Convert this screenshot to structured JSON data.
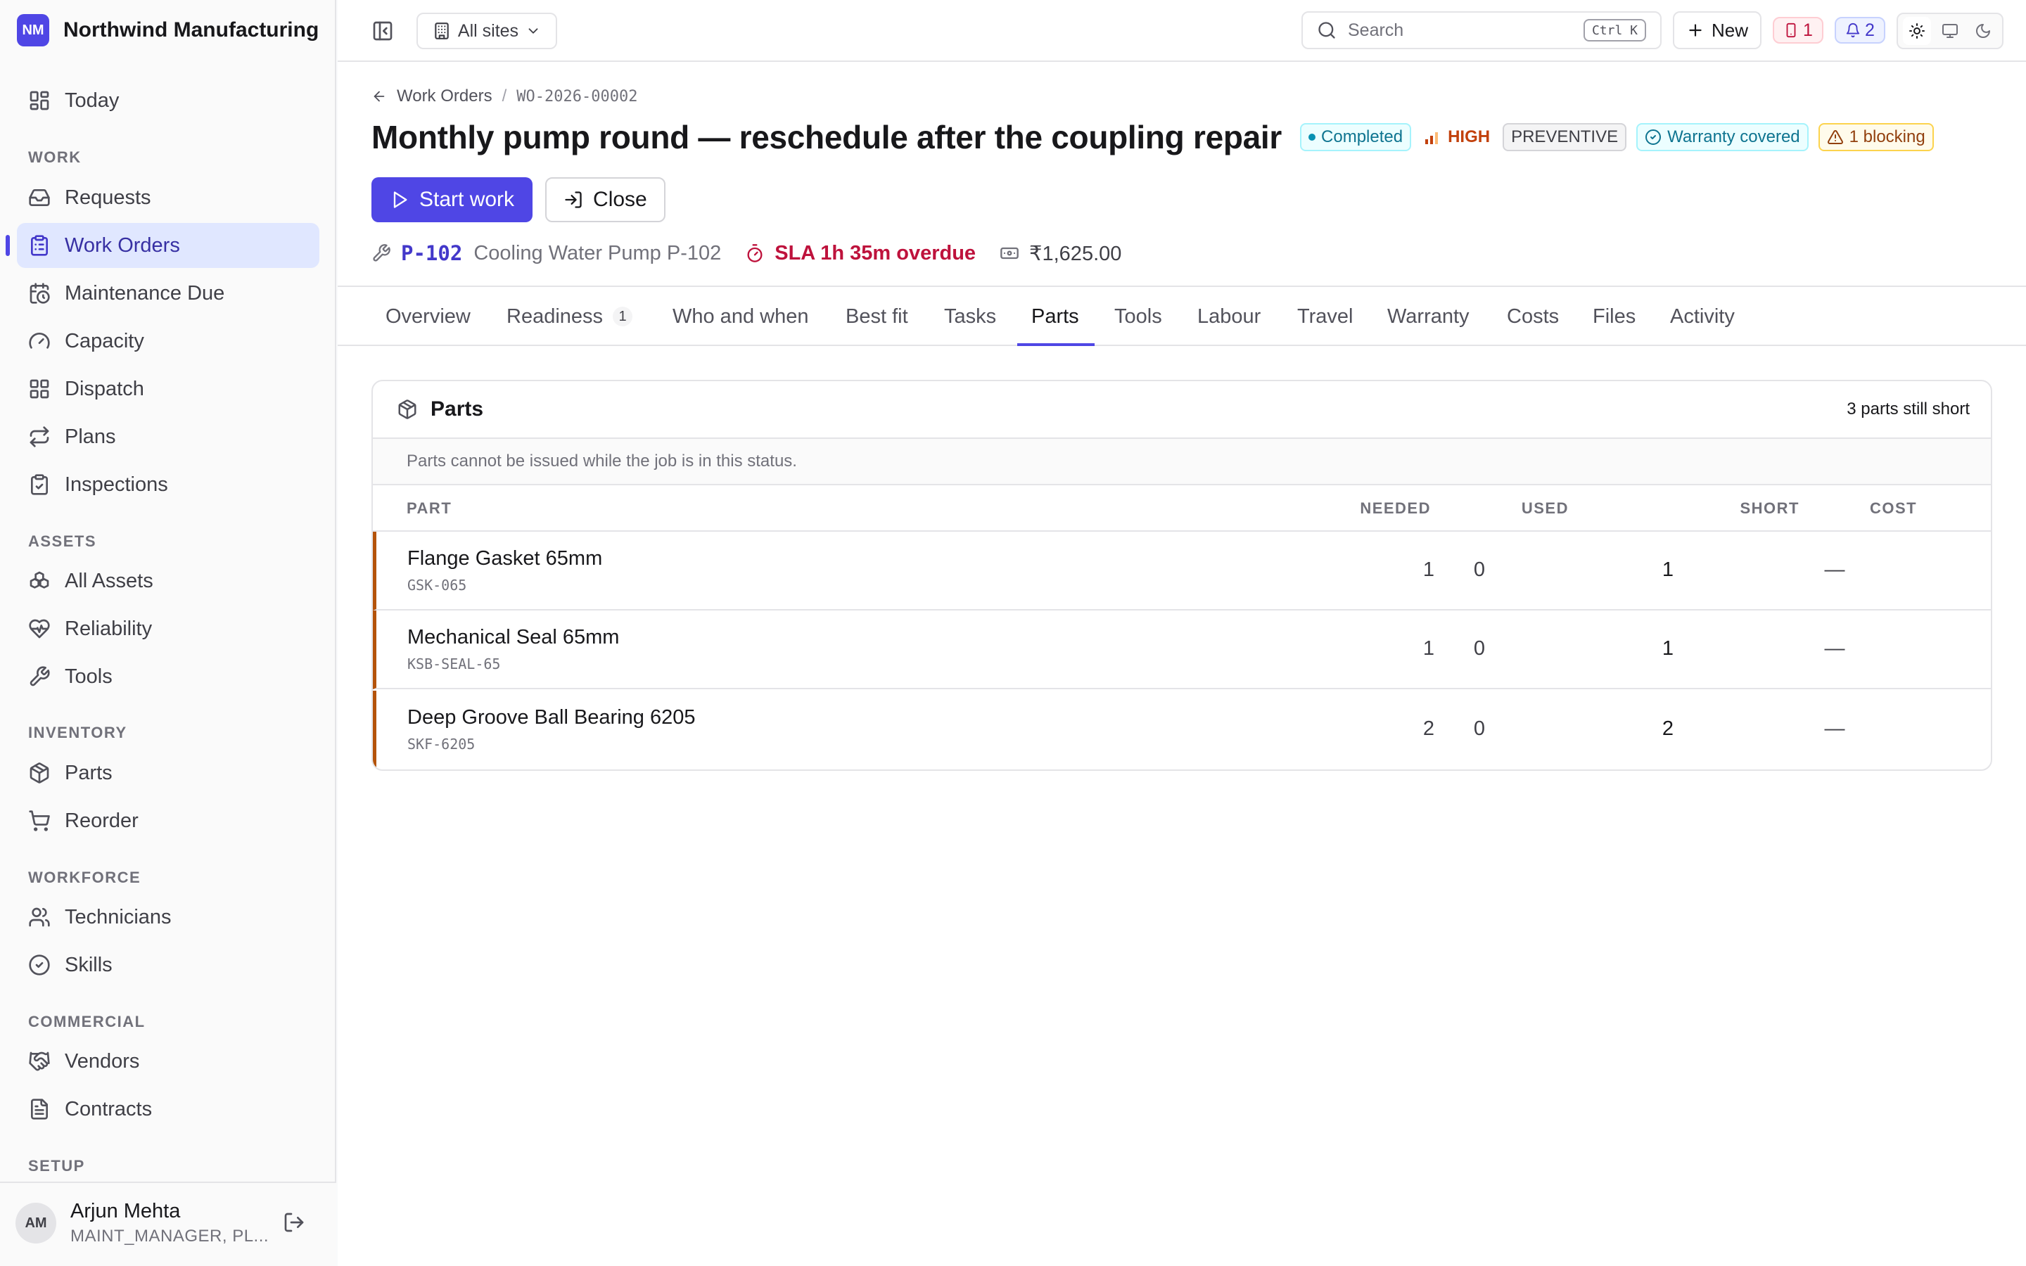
{
  "brand": {
    "initials": "NM",
    "name": "Northwind Manufacturing"
  },
  "sidebar": {
    "today": "Today",
    "sections": {
      "work": "WORK",
      "assets": "ASSETS",
      "inventory": "INVENTORY",
      "workforce": "WORKFORCE",
      "commercial": "COMMERCIAL",
      "setup": "SETUP"
    },
    "items": {
      "requests": "Requests",
      "work_orders": "Work Orders",
      "maintenance_due": "Maintenance Due",
      "capacity": "Capacity",
      "dispatch": "Dispatch",
      "plans": "Plans",
      "inspections": "Inspections",
      "all_assets": "All Assets",
      "reliability": "Reliability",
      "tools": "Tools",
      "parts": "Parts",
      "reorder": "Reorder",
      "technicians": "Technicians",
      "skills": "Skills",
      "vendors": "Vendors",
      "contracts": "Contracts"
    },
    "active": "Work Orders"
  },
  "user": {
    "initials": "AM",
    "name": "Arjun Mehta",
    "role": "MAINT_MANAGER, PL..."
  },
  "topbar": {
    "site_selector": "All sites",
    "search_placeholder": "Search",
    "search_shortcut": "Ctrl K",
    "new_label": "New",
    "alerts_count": "1",
    "notifications_count": "2"
  },
  "breadcrumb": {
    "parent": "Work Orders",
    "current": "WO-2026-00002"
  },
  "work_order": {
    "title": "Monthly pump round — reschedule after the coupling repair",
    "status": "Completed",
    "priority": "HIGH",
    "type": "PREVENTIVE",
    "warranty": "Warranty covered",
    "blocking": "1 blocking",
    "asset_code": "P-102",
    "asset_name": "Cooling Water Pump P-102",
    "sla": "SLA 1h 35m overdue",
    "cost": "₹1,625.00"
  },
  "actions": {
    "start": "Start work",
    "close": "Close"
  },
  "tabs": [
    {
      "label": "Overview"
    },
    {
      "label": "Readiness",
      "count": "1"
    },
    {
      "label": "Who and when"
    },
    {
      "label": "Best fit"
    },
    {
      "label": "Tasks"
    },
    {
      "label": "Parts",
      "active": true
    },
    {
      "label": "Tools"
    },
    {
      "label": "Labour"
    },
    {
      "label": "Travel"
    },
    {
      "label": "Warranty"
    },
    {
      "label": "Costs"
    },
    {
      "label": "Files"
    },
    {
      "label": "Activity"
    }
  ],
  "parts_card": {
    "title": "Parts",
    "summary": "3 parts still short",
    "note": "Parts cannot be issued while the job is in this status.",
    "columns": {
      "part": "PART",
      "needed": "NEEDED",
      "used": "USED",
      "short": "SHORT",
      "cost": "COST"
    },
    "rows": [
      {
        "name": "Flange Gasket 65mm",
        "sku": "GSK-065",
        "needed": "1",
        "used": "0",
        "short": "1",
        "cost": "—"
      },
      {
        "name": "Mechanical Seal 65mm",
        "sku": "KSB-SEAL-65",
        "needed": "1",
        "used": "0",
        "short": "1",
        "cost": "—"
      },
      {
        "name": "Deep Groove Ball Bearing 6205",
        "sku": "SKF-6205",
        "needed": "2",
        "used": "0",
        "short": "2",
        "cost": "—"
      }
    ]
  },
  "colors": {
    "accent": "#4f46e5",
    "short_row_marker": "#b45309",
    "overdue": "#be123c"
  }
}
